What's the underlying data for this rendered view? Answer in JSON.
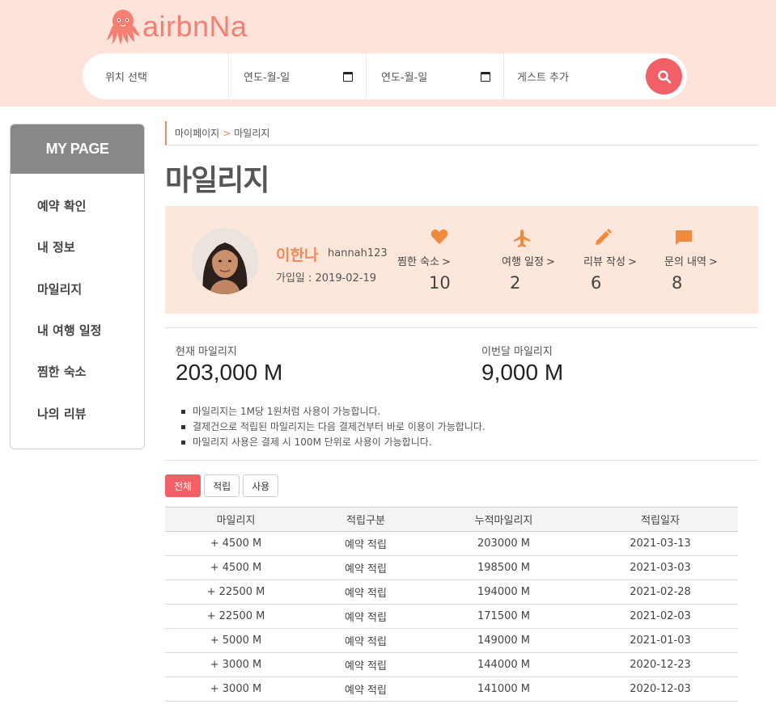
{
  "brand": {
    "logo_text": "airbnNa",
    "accent_color": "#f06066",
    "header_bg": "#fde3d9"
  },
  "search": {
    "location_placeholder": "위치 선택",
    "checkin_placeholder": "연도-월-일",
    "checkout_placeholder": "연도-월-일",
    "guest_placeholder": "게스트 추가",
    "calendar_icon": "calendar-icon",
    "search_icon": "search-icon"
  },
  "sidebar": {
    "title": "MY PAGE",
    "items": [
      {
        "label": "예약 확인"
      },
      {
        "label": "내 정보"
      },
      {
        "label": "마일리지"
      },
      {
        "label": "내 여행 일정"
      },
      {
        "label": "찜한 숙소"
      },
      {
        "label": "나의 리뷰"
      }
    ]
  },
  "breadcrumb": {
    "parent": "마이페이지",
    "separator": ">",
    "current": "마일리지"
  },
  "page_title": "마일리지",
  "profile": {
    "name": "이한나",
    "user_id": "hannah123",
    "join_date": "가입일 : 2019-02-19",
    "stats": [
      {
        "icon": "heart-icon",
        "label": "찜한 숙소",
        "count": "10"
      },
      {
        "icon": "airplane-icon",
        "label": "여행 일정",
        "count": "2"
      },
      {
        "icon": "pencil-icon",
        "label": "리뷰 작성",
        "count": "6"
      },
      {
        "icon": "chat-icon",
        "label": "문의 내역",
        "count": "8"
      }
    ],
    "chevron": ">"
  },
  "mileage": {
    "current_label": "현재 마일리지",
    "current_value": "203,000 M",
    "month_label": "이번달 마일리지",
    "month_value": "9,000 M",
    "notes": [
      "마일리지는 1M당 1원처럼 사용이 가능합니다.",
      "결제건으로 적립된 마일리지는 다음 결제건부터 바로 이용이 가능합니다.",
      "마일리지 사용은 결제 시 100M 단위로 사용이 가능합니다."
    ]
  },
  "filters": [
    {
      "label": "전체",
      "active": true
    },
    {
      "label": "적립"
    },
    {
      "label": "사용"
    }
  ],
  "table": {
    "headers": [
      "마일리지",
      "적립구분",
      "누적마일리지",
      "적립일자"
    ],
    "rows": [
      [
        "+ 4500 M",
        "예약 적립",
        "203000 M",
        "2021-03-13"
      ],
      [
        "+ 4500 M",
        "예약 적립",
        "198500 M",
        "2021-03-03"
      ],
      [
        "+ 22500 M",
        "예약 적립",
        "194000 M",
        "2021-02-28"
      ],
      [
        "+ 22500 M",
        "예약 적립",
        "171500 M",
        "2021-02-03"
      ],
      [
        "+ 5000 M",
        "예약 적립",
        "149000 M",
        "2021-01-03"
      ],
      [
        "+ 3000 M",
        "예약 적립",
        "144000 M",
        "2020-12-23"
      ],
      [
        "+ 3000 M",
        "예약 적립",
        "141000 M",
        "2020-12-03"
      ]
    ]
  }
}
